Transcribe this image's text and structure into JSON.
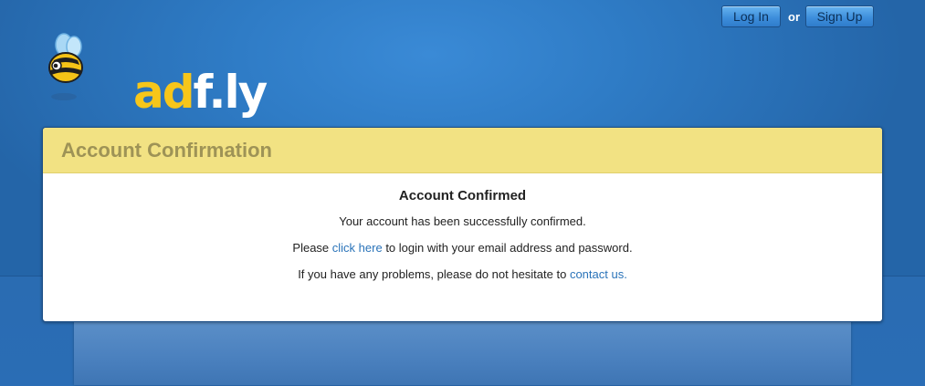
{
  "header": {
    "login_label": "Log In",
    "or_text": "or",
    "signup_label": "Sign Up"
  },
  "logo": {
    "text_ad": "ad",
    "text_fly": "f.ly"
  },
  "card": {
    "title": "Account Confirmation",
    "heading": "Account Confirmed",
    "line1": "Your account has been successfully confirmed.",
    "line2_prefix": "Please ",
    "line2_link": "click here",
    "line2_suffix": " to login with your email address and password.",
    "line3_prefix": "If you have any problems, please do not hesitate to ",
    "line3_link": "contact us."
  },
  "colors": {
    "background": "#2a6db5",
    "header_band": "#f2e283",
    "title_text": "#9e9356",
    "link": "#2a73b9",
    "logo_yellow": "#f7c61a"
  }
}
